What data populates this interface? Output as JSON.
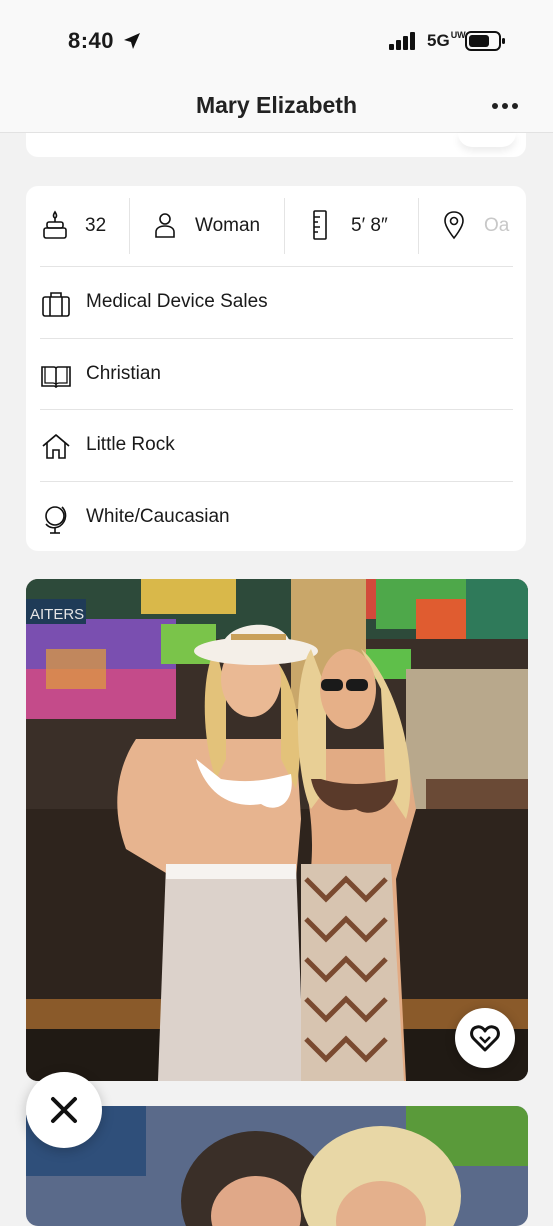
{
  "status_bar": {
    "time": "8:40",
    "network": "5G",
    "network_superscript": "UW"
  },
  "header": {
    "title": "Mary Elizabeth"
  },
  "vitals": [
    {
      "icon": "cake-icon",
      "value": "32"
    },
    {
      "icon": "person-icon",
      "value": "Woman"
    },
    {
      "icon": "ruler-icon",
      "value": "5′ 8″"
    },
    {
      "icon": "location-pin-icon",
      "value": "Oa"
    }
  ],
  "details": [
    {
      "icon": "briefcase-icon",
      "value": "Medical Device Sales"
    },
    {
      "icon": "book-icon",
      "value": "Christian"
    },
    {
      "icon": "home-icon",
      "value": "Little Rock"
    },
    {
      "icon": "globe-icon",
      "value": "White/Caucasian"
    }
  ],
  "photo": {
    "sign_text": "AITERS"
  },
  "colors": {
    "background": "#f2f2f2",
    "card": "#ffffff",
    "text": "#1a1a1a",
    "divider": "#e4e4e4",
    "faded_text": "#c8c8c8"
  }
}
